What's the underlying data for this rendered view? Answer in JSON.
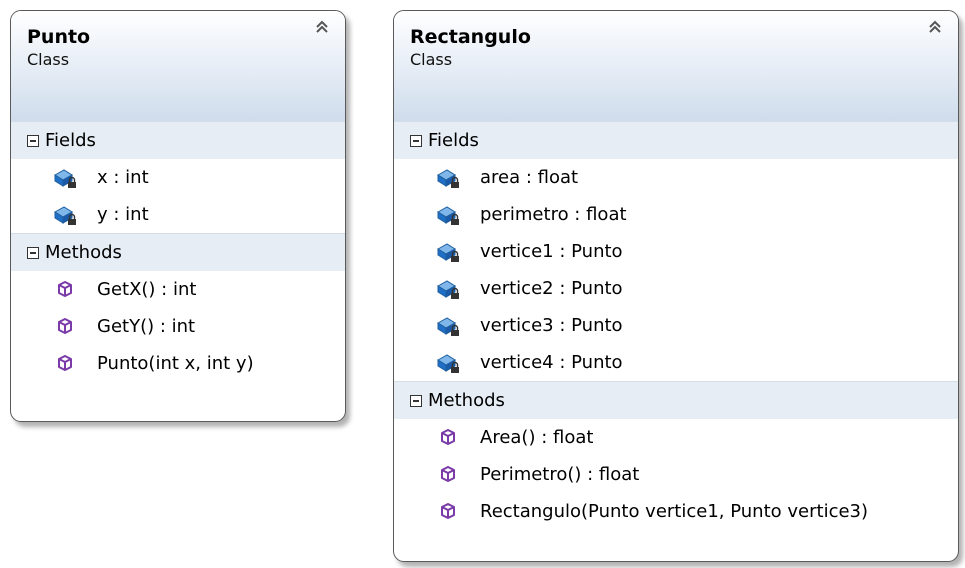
{
  "classes": [
    {
      "name": "Punto",
      "kind": "Class",
      "sections": {
        "fields": {
          "label": "Fields",
          "items": [
            "x : int",
            "y : int"
          ]
        },
        "methods": {
          "label": "Methods",
          "items": [
            "GetX() : int",
            "GetY() : int",
            "Punto(int x, int y)"
          ]
        }
      }
    },
    {
      "name": "Rectangulo",
      "kind": "Class",
      "sections": {
        "fields": {
          "label": "Fields",
          "items": [
            "area : float",
            "perimetro : float",
            "vertice1 : Punto",
            "vertice2 : Punto",
            "vertice3 : Punto",
            "vertice4 : Punto"
          ]
        },
        "methods": {
          "label": "Methods",
          "items": [
            "Area() : float",
            "Perimetro() : float",
            "Rectangulo(Punto vertice1, Punto vertice3)"
          ]
        }
      }
    }
  ],
  "icons": {
    "field": "private-field-icon",
    "method": "method-icon",
    "collapse": "collapse-chevrons-icon",
    "section_toggle": "collapse-minus-icon"
  },
  "colors": {
    "header_gradient_top": "#ffffff",
    "header_gradient_bottom": "#cfdcec",
    "section_bg": "#e6edf5",
    "border": "#5a5a5a",
    "field_icon": "#1f6fc6",
    "method_icon": "#7a3aa8"
  }
}
